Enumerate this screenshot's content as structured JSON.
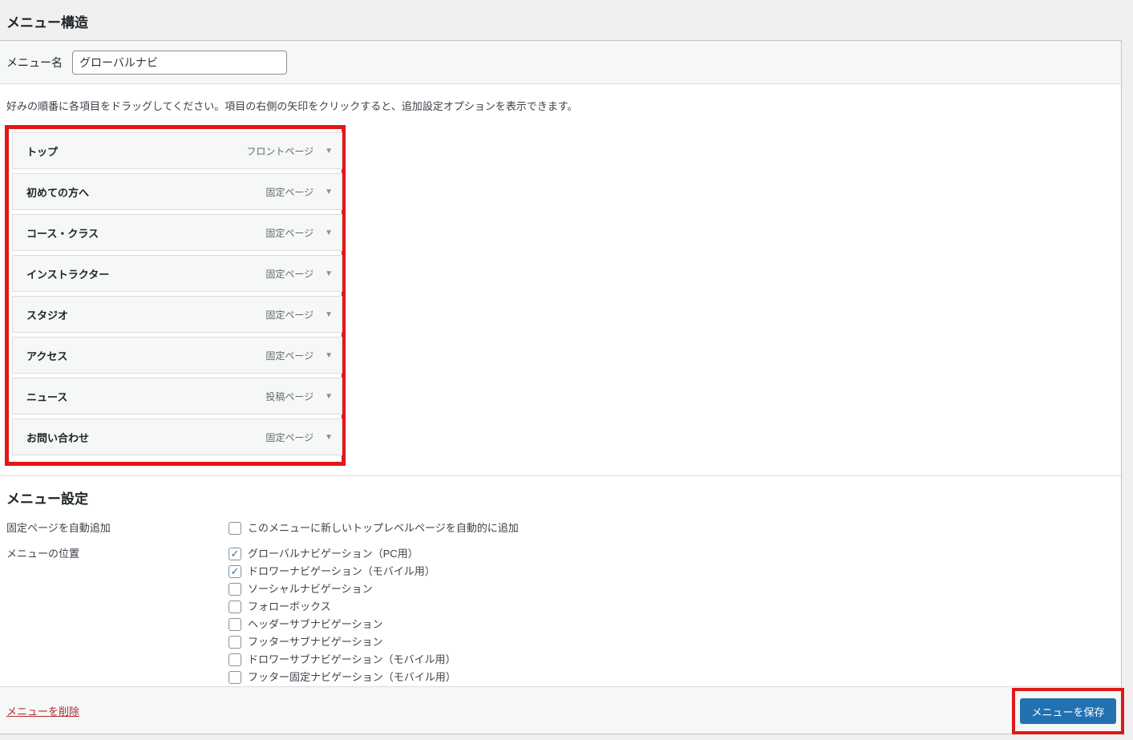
{
  "page_title": "メニュー構造",
  "menu_name": {
    "label": "メニュー名",
    "value": "グローバルナビ"
  },
  "instruction": "好みの順番に各項目をドラッグしてください。項目の右側の矢印をクリックすると、追加設定オプションを表示できます。",
  "menu_items": [
    {
      "label": "トップ",
      "type": "フロントページ"
    },
    {
      "label": "初めての方へ",
      "type": "固定ページ"
    },
    {
      "label": "コース・クラス",
      "type": "固定ページ"
    },
    {
      "label": "インストラクター",
      "type": "固定ページ"
    },
    {
      "label": "スタジオ",
      "type": "固定ページ"
    },
    {
      "label": "アクセス",
      "type": "固定ページ"
    },
    {
      "label": "ニュース",
      "type": "投稿ページ"
    },
    {
      "label": "お問い合わせ",
      "type": "固定ページ"
    }
  ],
  "settings": {
    "heading": "メニュー設定",
    "auto_add": {
      "label": "固定ページを自動追加",
      "option": "このメニューに新しいトップレベルページを自動的に追加",
      "checked": false,
      "glyph": ""
    },
    "location": {
      "label": "メニューの位置",
      "options": [
        {
          "label": "グローバルナビゲーション（PC用）",
          "checked": true,
          "glyph": "✓"
        },
        {
          "label": "ドロワーナビゲーション（モバイル用）",
          "checked": true,
          "glyph": "✓"
        },
        {
          "label": "ソーシャルナビゲーション",
          "checked": false,
          "glyph": ""
        },
        {
          "label": "フォローボックス",
          "checked": false,
          "glyph": ""
        },
        {
          "label": "ヘッダーサブナビゲーション",
          "checked": false,
          "glyph": ""
        },
        {
          "label": "フッターサブナビゲーション",
          "checked": false,
          "glyph": ""
        },
        {
          "label": "ドロワーサブナビゲーション（モバイル用）",
          "checked": false,
          "glyph": ""
        },
        {
          "label": "フッター固定ナビゲーション（モバイル用）",
          "checked": false,
          "glyph": ""
        }
      ]
    }
  },
  "footer": {
    "delete_label": "メニューを削除",
    "save_label": "メニューを保存"
  },
  "icons": {
    "chevron_down": "▼"
  },
  "colors": {
    "accent_blue": "#2271b1",
    "annotation_red": "#e01818",
    "delete_link_red": "#b32d2e",
    "row_gray": "#f6f7f7",
    "page_bg": "#f0f0f1"
  }
}
